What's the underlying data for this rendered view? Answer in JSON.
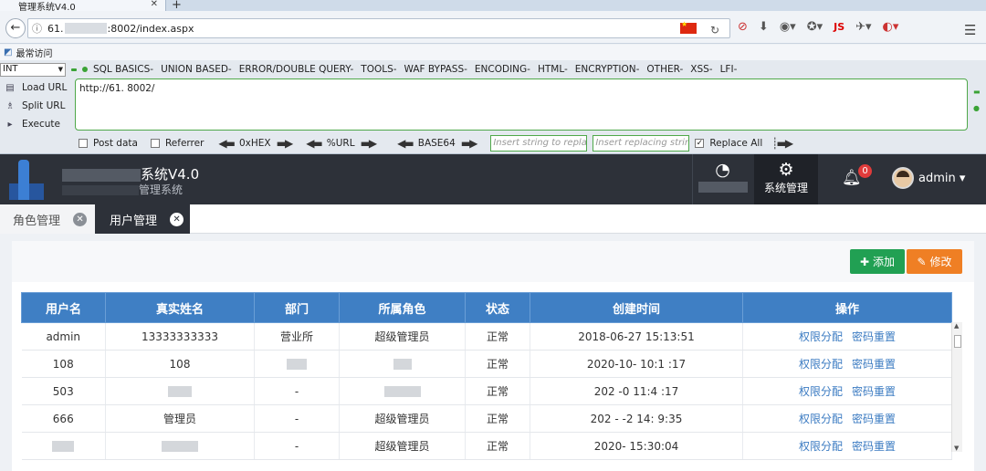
{
  "browser": {
    "tab_title": "管理系统V4.0",
    "url": "61.        :8002/index.aspx",
    "url_prefix": "61.",
    "url_suffix": ":8002/index.aspx",
    "js_label": "JS"
  },
  "bookmarks": {
    "label": "最常访问"
  },
  "hackbar": {
    "type_select": "INT",
    "menu": [
      "SQL BASICS-",
      "UNION BASED-",
      "ERROR/DOUBLE QUERY-",
      "TOOLS-",
      "WAF BYPASS-",
      "ENCODING-",
      "HTML-",
      "ENCRYPTION-",
      "OTHER-",
      "XSS-",
      "LFI-"
    ],
    "load_url": "Load URL",
    "split_url": "Split URL",
    "execute": "Execute",
    "textarea_value": "http://61.          8002/",
    "post_data": "Post data",
    "referrer": "Referrer",
    "hex": "0xHEX",
    "url_enc": "%URL",
    "base64": "BASE64",
    "insert_placeholder": "Insert string to replace",
    "replacing_placeholder": "Insert replacing string",
    "replace_all": "Replace All"
  },
  "app": {
    "title_suffix": "系统V4.0",
    "subtitle_suffix": "管理系统",
    "system_manage": "系统管理",
    "notification_count": "0",
    "username": "admin"
  },
  "page_tabs": [
    {
      "label": "角色管理",
      "active": false
    },
    {
      "label": "用户管理",
      "active": true
    }
  ],
  "toolbar": {
    "add_label": "添加",
    "edit_label": "修改"
  },
  "table": {
    "headers": [
      "用户名",
      "真实姓名",
      "部门",
      "所属角色",
      "状态",
      "创建时间",
      "操作"
    ],
    "rows": [
      {
        "username": "admin",
        "realname": "13333333333",
        "dept": "营业所",
        "role": "超级管理员",
        "status": "正常",
        "created": "2018-06-27 15:13:51"
      },
      {
        "username": "108",
        "realname": "108",
        "dept": "",
        "role": "",
        "status": "正常",
        "created": "2020-10-  10:1 :17"
      },
      {
        "username": "503",
        "realname": "",
        "dept": "-",
        "role": "",
        "status": "正常",
        "created": "202 -0  11:4 :17"
      },
      {
        "username": "666",
        "realname": "管理员",
        "dept": "-",
        "role": "超级管理员",
        "status": "正常",
        "created": "202 - -2 14: 9:35"
      },
      {
        "username": "",
        "realname": "",
        "dept": "-",
        "role": "超级管理员",
        "status": "正常",
        "created": "2020-     15:30:04"
      }
    ],
    "op_perm": "权限分配",
    "op_reset": "密码重置"
  }
}
